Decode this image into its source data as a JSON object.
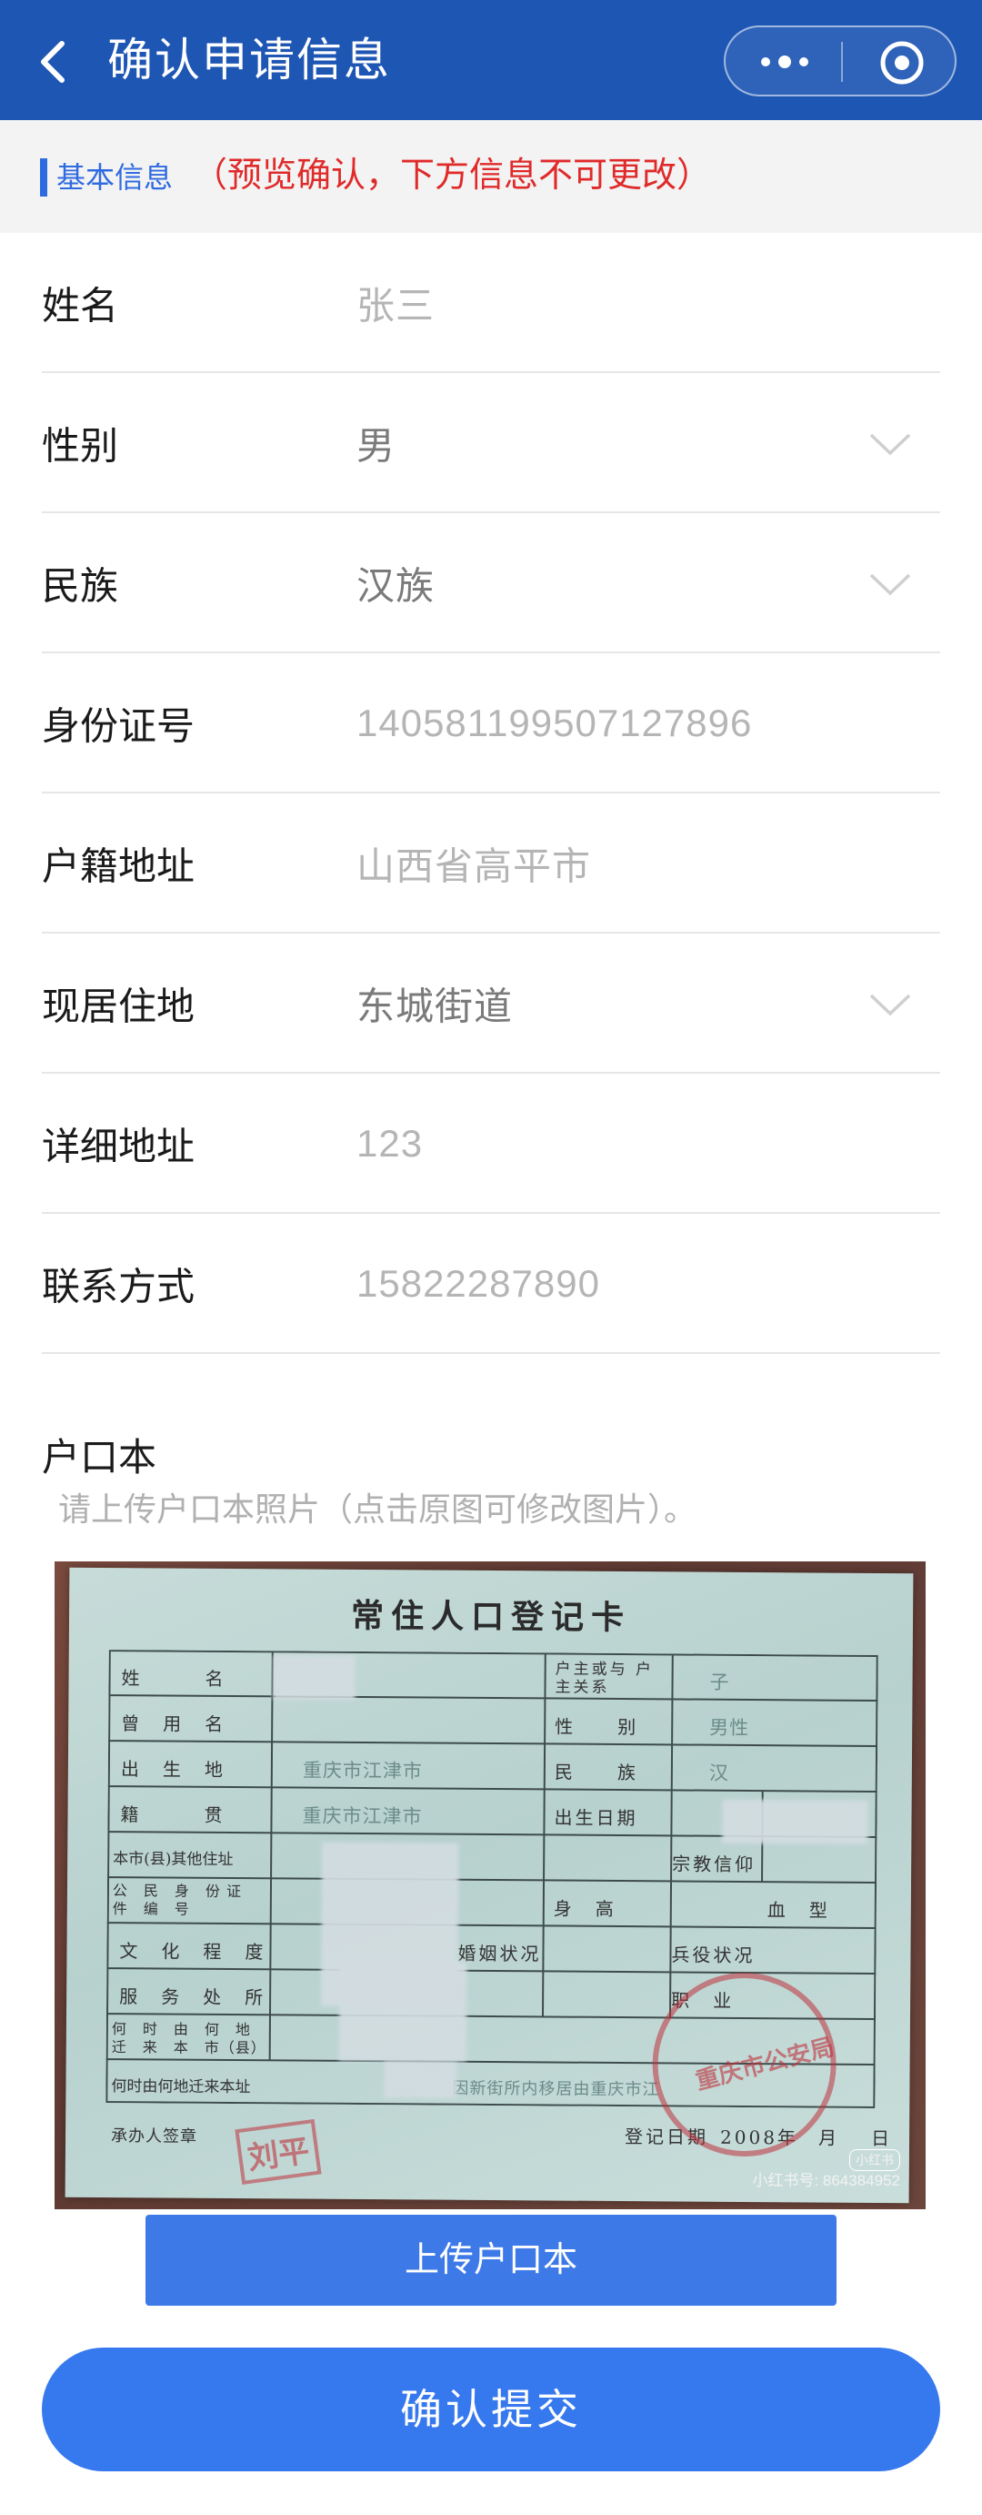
{
  "header": {
    "title": "确认申请信息",
    "back_icon": "chevron-left-icon",
    "more_icon": "more-dots-icon",
    "close_icon": "target-circle-icon",
    "background": "#1e56b4"
  },
  "notice": {
    "label": "基本信息",
    "note": "（预览确认，下方信息不可更改）",
    "note_color": "#e02a2a",
    "accent": "#2f6be0"
  },
  "form": {
    "fields": [
      {
        "label": "姓名",
        "value": "张三",
        "type": "text"
      },
      {
        "label": "性别",
        "value": "男",
        "type": "select"
      },
      {
        "label": "民族",
        "value": "汉族",
        "type": "select"
      },
      {
        "label": "身份证号",
        "value": "140581199507127896",
        "type": "text"
      },
      {
        "label": "户籍地址",
        "value": "山西省高平市",
        "type": "text"
      },
      {
        "label": "现居住地",
        "value": "东城街道",
        "type": "select"
      },
      {
        "label": "详细地址",
        "value": "123",
        "type": "text"
      },
      {
        "label": "联系方式",
        "value": "15822287890",
        "type": "text"
      }
    ]
  },
  "hukou": {
    "title": "户口本",
    "hint": "请上传户口本照片（点击原图可修改图片）。",
    "card": {
      "title": "常住人口登记卡",
      "labels": {
        "name": "姓　　　名",
        "used_name": "曾　用　名",
        "birthplace": "出　生　地",
        "origin": "籍　　　贯",
        "other_address": "本市(县)其他住址",
        "id_number": "公　民　身　份 证　件　编　号",
        "education": "文　化　程　度",
        "workplace": "服　务　处　所",
        "moved_in": "何　时　由　何　地 迁　来　本　市（县）",
        "moved_in_address": "何时由何地迁来本址",
        "officer": "承办人签章",
        "relation": "户主或与 户主关系",
        "gender": "性　　别",
        "ethnicity": "民　　族",
        "birth_date": "出生日期",
        "religion": "宗教信仰",
        "height": "身　高",
        "blood_type": "血　型",
        "marital": "婚姻状况",
        "military": "兵役状况",
        "occupation": "职　业",
        "reg_date": "登记日期",
        "year": "2008年",
        "month": "月",
        "day": "日"
      },
      "values": {
        "relation": "子",
        "gender": "男性",
        "ethnicity": "汉",
        "birthplace": "重庆市江津市",
        "origin": "重庆市江津市",
        "note": "因新街所内移居由重庆市江"
      },
      "stamp_text": "重庆市公安局",
      "officer_stamp": "刘平"
    },
    "watermark": {
      "badge": "小红书",
      "id": "小红书号: 864384952"
    },
    "upload_label": "上传户口本"
  },
  "submit_label": "确认提交"
}
